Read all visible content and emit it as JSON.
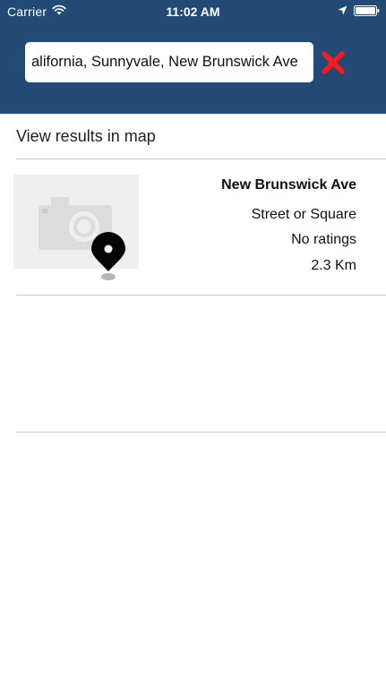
{
  "status_bar": {
    "carrier": "Carrier",
    "time": "11:02 AM",
    "icons": [
      "wifi-icon",
      "location-arrow-icon",
      "battery-icon"
    ]
  },
  "search": {
    "value": "alifornia, Sunnyvale, New Brunswick Ave",
    "clear_icon": "close-icon",
    "clear_color": "#ff1a1a"
  },
  "view_map": {
    "label": "View results in map"
  },
  "results": [
    {
      "name": "New Brunswick Ave",
      "type": "Street or Square",
      "rating": "No ratings",
      "distance": "2.3 Km",
      "thumbnail_icon": "camera-placeholder-icon",
      "marker_icon": "map-pin-icon"
    }
  ],
  "colors": {
    "header_background": "#234a74",
    "divider": "#c8c8cc"
  }
}
